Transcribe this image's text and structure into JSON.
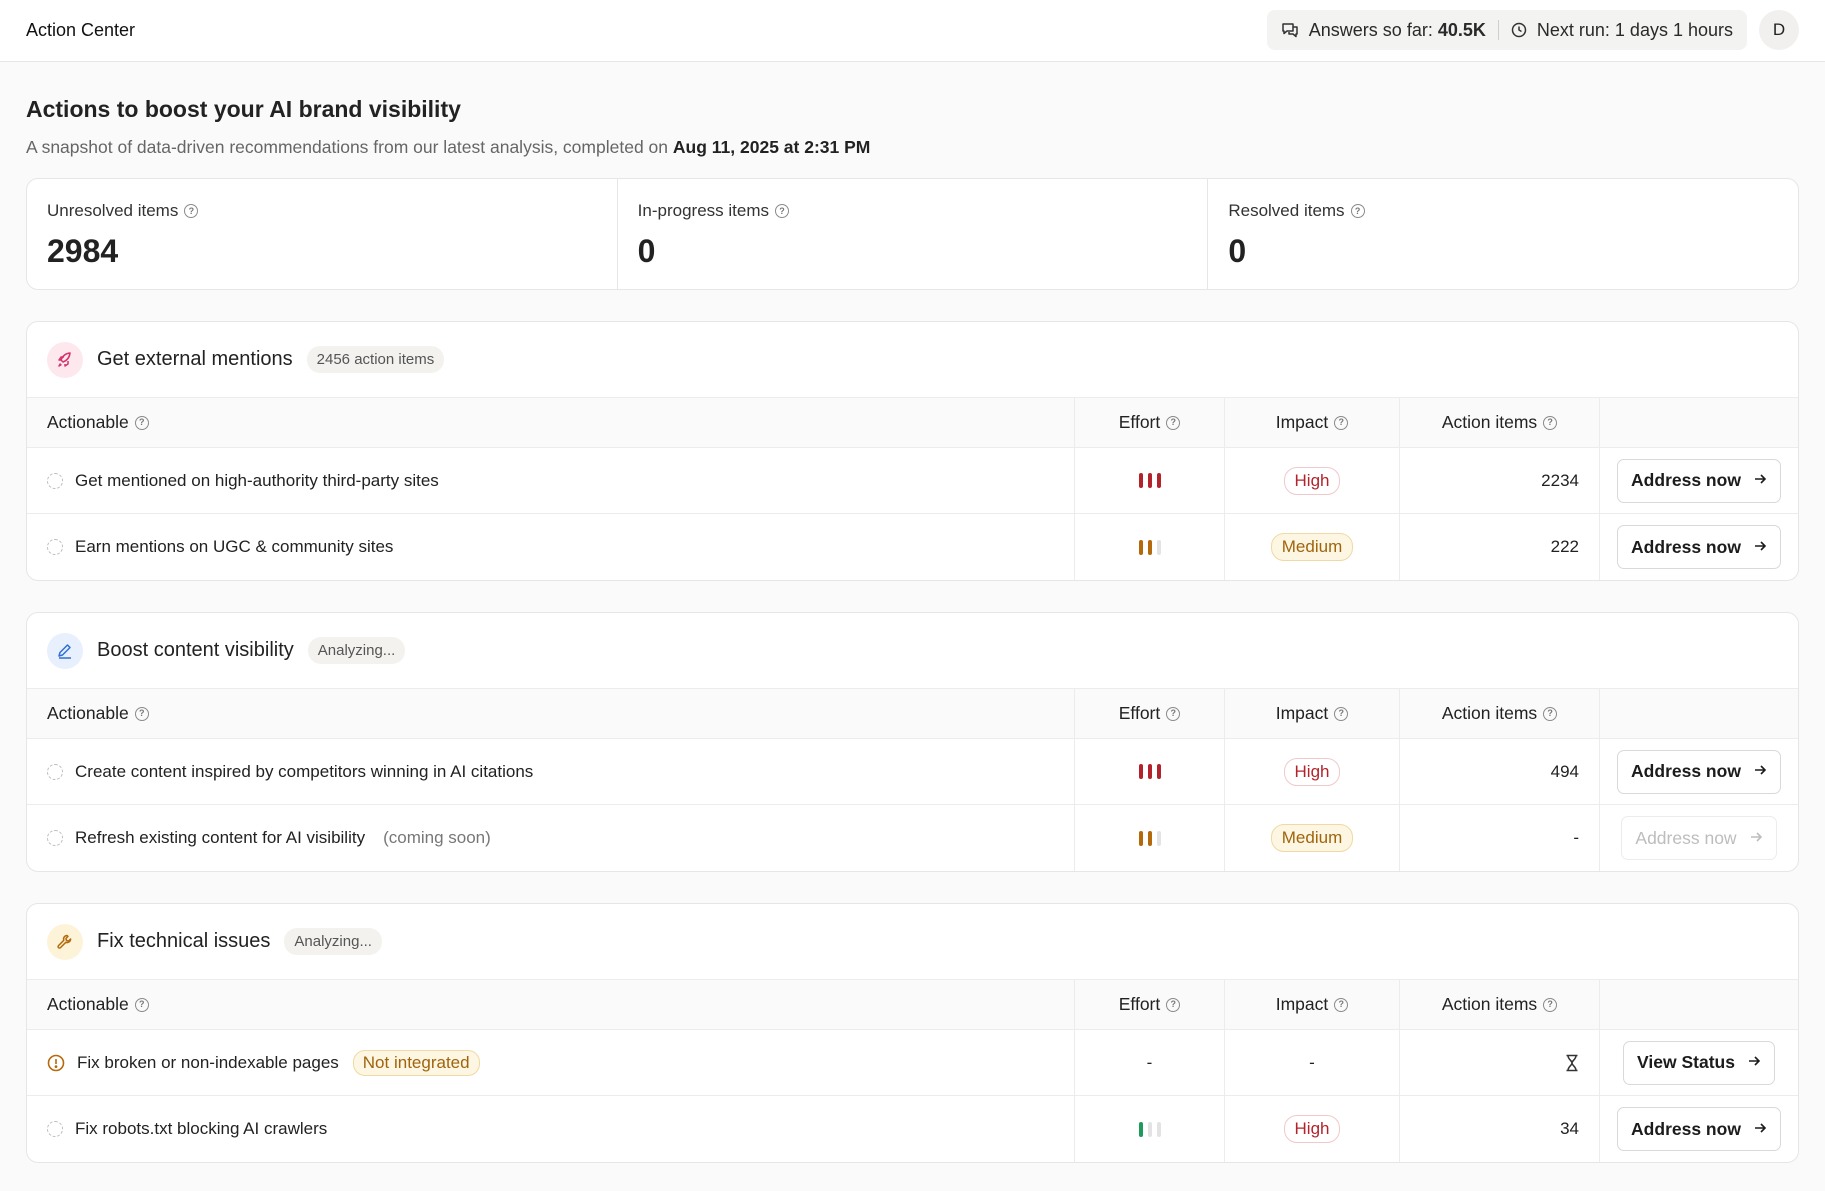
{
  "topbar": {
    "title": "Action Center",
    "answers_label": "Answers so far:",
    "answers_value": "40.5K",
    "next_run": "Next run: 1 days 1 hours",
    "avatar_initial": "D"
  },
  "page": {
    "title": "Actions to boost your AI brand visibility",
    "subtitle": "A snapshot of data-driven recommendations from our latest analysis, completed on",
    "date": "Aug 11, 2025 at 2:31 PM"
  },
  "stats": {
    "unresolved_label": "Unresolved items",
    "unresolved_value": "2984",
    "inprogress_label": "In-progress items",
    "inprogress_value": "0",
    "resolved_label": "Resolved items",
    "resolved_value": "0"
  },
  "table_headers": {
    "actionable": "Actionable",
    "effort": "Effort",
    "impact": "Impact",
    "action_items": "Action items"
  },
  "sections": [
    {
      "title": "Get external mentions",
      "badge": "2456 action items",
      "icon": "rocket-icon",
      "rows": [
        {
          "label": "Get mentioned on high-authority third-party sites",
          "effort": 3,
          "impact": "High",
          "count": "2234",
          "button": "Address now"
        },
        {
          "label": "Earn mentions on UGC & community sites",
          "effort": 2,
          "impact": "Medium",
          "count": "222",
          "button": "Address now"
        }
      ]
    },
    {
      "title": "Boost content visibility",
      "badge": "Analyzing...",
      "icon": "pen-icon",
      "rows": [
        {
          "label": "Create content inspired by competitors winning in AI citations",
          "effort": 3,
          "impact": "High",
          "count": "494",
          "button": "Address now"
        },
        {
          "label": "Refresh existing content for AI visibility",
          "note": "(coming soon)",
          "effort": 2,
          "impact": "Medium",
          "count": "-",
          "button": "Address now",
          "disabled": true
        }
      ]
    },
    {
      "title": "Fix technical issues",
      "badge": "Analyzing...",
      "icon": "wrench-icon",
      "rows": [
        {
          "label": "Fix broken or non-indexable pages",
          "tag": "Not integrated",
          "effort": "-",
          "impact": "-",
          "count": "hourglass",
          "button": "View Status"
        },
        {
          "label": "Fix robots.txt blocking AI crawlers",
          "effort": 1,
          "impact": "High",
          "count": "34",
          "button": "Address now"
        }
      ]
    }
  ],
  "colors": {
    "high": "#b3232b",
    "medium": "#a0640c",
    "low_effort": "#1e9a5a"
  }
}
